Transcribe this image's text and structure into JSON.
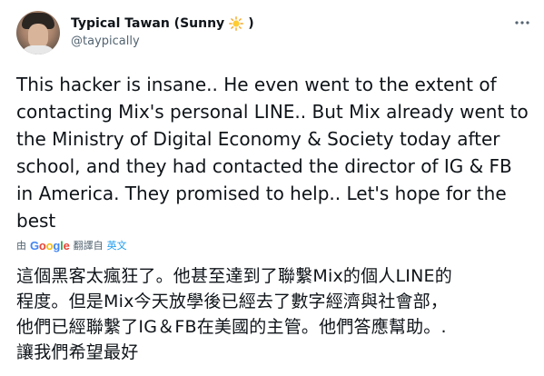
{
  "author": {
    "display_name": "Typical Tawan (Sunny",
    "name_suffix": ")",
    "emoji_icon": "sun-icon",
    "handle": "@taypically"
  },
  "tweet": {
    "text": "This hacker is insane.. He even went to the extent of\ncontacting Mix's personal LINE.. But Mix already went to\nthe Ministry of Digital Economy & Society today after\nschool, and they had contacted the director of IG & FB\nin America. They promised to help.. Let's hope for the\nbest"
  },
  "translation": {
    "by_label": "由",
    "provider": "Google",
    "action_label": "翻譯自",
    "source_language": "英文",
    "lines": [
      "這個黑客太瘋狂了。他甚至達到了聯繫Mix的個人LINE的",
      "程度。但是Mix今天放學後已經去了數字經濟與社會部，",
      "他們已經聯繫了IG＆FB在美國的主管。他們答應幫助。.",
      "讓我們希望最好"
    ]
  },
  "colors": {
    "text_primary": "#0f1419",
    "text_secondary": "#536471",
    "link": "#1d9bf0"
  }
}
